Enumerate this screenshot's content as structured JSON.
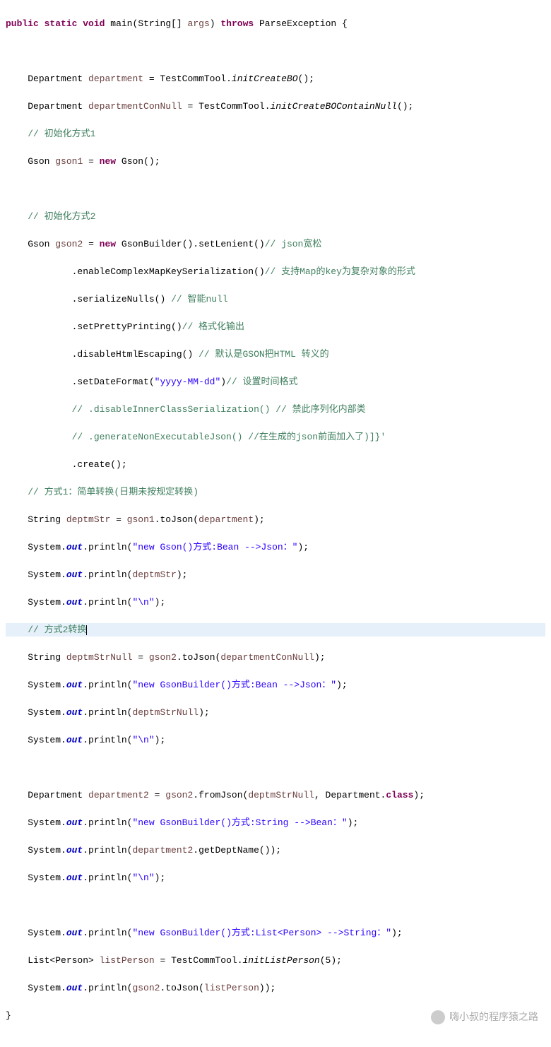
{
  "sig": {
    "kw_public": "public",
    "kw_static": "static",
    "kw_void": "void",
    "name": "main",
    "param_type": "String[]",
    "param_name": "args",
    "kw_throws": "throws",
    "exc": "ParseException"
  },
  "l1": {
    "type": "Department",
    "var": "department",
    "rhs": "TestCommTool.",
    "m": "initCreateBO",
    "tail": "();"
  },
  "l2": {
    "type": "Department",
    "var": "departmentConNull",
    "rhs": "TestCommTool.",
    "m": "initCreateBOContainNull",
    "tail": "();"
  },
  "c1": "// 初始化方式1",
  "l3": {
    "type": "Gson",
    "var": "gson1",
    "kw_new": "new",
    "ctor": "Gson();"
  },
  "c2": "// 初始化方式2",
  "l4": {
    "type": "Gson",
    "var": "gson2",
    "kw_new": "new",
    "ctor": "GsonBuilder().setLenient()",
    "cmt": "// json宽松"
  },
  "l5": {
    "m": ".enableComplexMapKeySerialization()",
    "cmt": "// 支持Map的key为复杂对象的形式"
  },
  "l6": {
    "m": ".serializeNulls() ",
    "cmt": "// 智能null"
  },
  "l7": {
    "m": ".setPrettyPrinting()",
    "cmt": "// 格式化输出"
  },
  "l8": {
    "m": ".disableHtmlEscaping() ",
    "cmt": "// 默认是GSON把HTML 转义的"
  },
  "l9": {
    "m": ".setDateFormat(",
    "str": "\"yyyy-MM-dd\"",
    "tail": ")",
    "cmt": "// 设置时间格式"
  },
  "l10": {
    "cmt": "// .disableInnerClassSerialization() // 禁此序列化内部类"
  },
  "l11": {
    "cmt": "// .generateNonExecutableJson() //在生成的json前面加入了)]}'"
  },
  "l12": {
    "m": ".create();"
  },
  "c3": "// 方式1：简单转换(日期未按规定转换)",
  "l13": {
    "type": "String",
    "var": "deptmStr",
    "rhs": "gson1",
    "m": ".toJson(",
    "arg": "department",
    "tail": ");"
  },
  "l14": {
    "str": "\"new Gson()方式:Bean -->Json：\""
  },
  "l15": {
    "arg": "deptmStr"
  },
  "l16": {
    "str": "\"\\n\""
  },
  "c4": "// 方式2转换",
  "l17": {
    "type": "String",
    "var": "deptmStrNull",
    "rhs": "gson2",
    "m": ".toJson(",
    "arg": "departmentConNull",
    "tail": ");"
  },
  "l18": {
    "str": "\"new GsonBuilder()方式:Bean -->Json：\""
  },
  "l19": {
    "arg": "deptmStrNull"
  },
  "l20": {
    "str": "\"\\n\""
  },
  "l21": {
    "type": "Department",
    "var": "department2",
    "rhs": "gson2",
    "m": ".fromJson(",
    "arg1": "deptmStrNull",
    "cls": "Department.",
    "kw": "class",
    "tail": ");"
  },
  "l22": {
    "str": "\"new GsonBuilder()方式:String -->Bean：\""
  },
  "l23": {
    "obj": "department2",
    "m": ".getDeptName()"
  },
  "l24": {
    "str": "\"\\n\""
  },
  "l25": {
    "str": "\"new GsonBuilder()方式:List<Person> -->String：\""
  },
  "l26": {
    "type": "List<Person>",
    "var": "listPerson",
    "rhs": "TestCommTool.",
    "m": "initListPerson",
    "arg": "5",
    "tail": ");"
  },
  "l27": {
    "obj": "gson2",
    "m": ".toJson(",
    "arg": "listPerson",
    "tail": "));"
  },
  "sys": {
    "obj": "System.",
    "field": "out",
    "m": ".println("
  },
  "watermark": "嗨小叔的程序猿之路"
}
